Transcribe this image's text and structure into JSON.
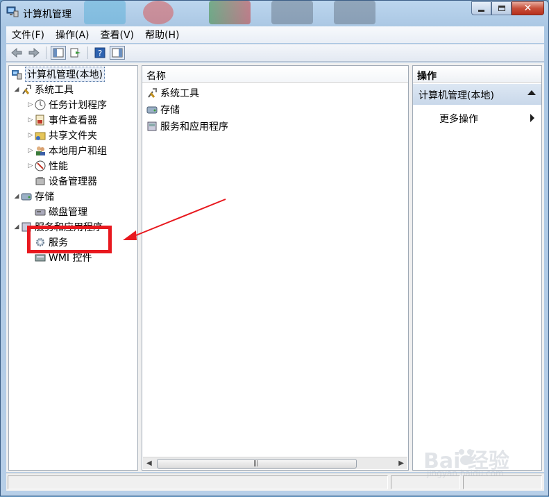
{
  "window": {
    "title": "计算机管理"
  },
  "menu": [
    {
      "label": "文件(F)"
    },
    {
      "label": "操作(A)"
    },
    {
      "label": "查看(V)"
    },
    {
      "label": "帮助(H)"
    }
  ],
  "tree": {
    "root": "计算机管理(本地)",
    "system_tools": "系统工具",
    "task_scheduler": "任务计划程序",
    "event_viewer": "事件查看器",
    "shared_folders": "共享文件夹",
    "local_users": "本地用户和组",
    "performance": "性能",
    "device_manager": "设备管理器",
    "storage": "存储",
    "disk_management": "磁盘管理",
    "services_apps": "服务和应用程序",
    "services": "服务",
    "wmi": "WMI 控件"
  },
  "list": {
    "column_name": "名称",
    "items": [
      "系统工具",
      "存储",
      "服务和应用程序"
    ]
  },
  "actions": {
    "title": "操作",
    "section": "计算机管理(本地)",
    "more": "更多操作"
  },
  "watermark": {
    "brand": "Bai 经验",
    "url": "jingyan.baidu.com"
  },
  "colors": {
    "highlight": "#e8181e",
    "arrow": "#e8181e",
    "action_section": "#c9d8ea"
  }
}
